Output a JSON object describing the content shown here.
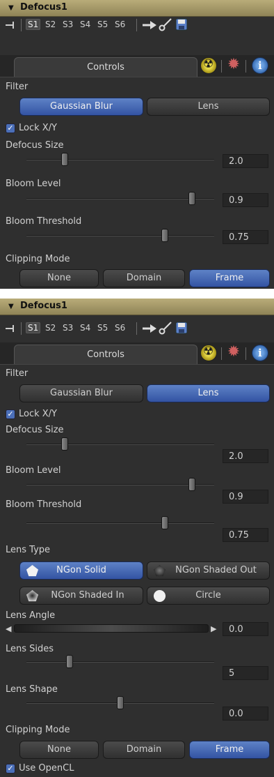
{
  "top": {
    "title": "Defocus1",
    "toolbar": {
      "slots": [
        "S1",
        "S2",
        "S3",
        "S4",
        "S5",
        "S6"
      ],
      "icons": [
        "pin-icon",
        "arrow-right-icon",
        "link-icon",
        "save-icon"
      ]
    },
    "tabs": {
      "controls": "Controls",
      "icons": [
        "radiation-icon",
        "gear-icon",
        "info-icon"
      ]
    },
    "filter": {
      "label": "Filter",
      "options": [
        "Gaussian Blur",
        "Lens"
      ],
      "selected": "Gaussian Blur"
    },
    "lock_xy": {
      "label": "Lock X/Y",
      "checked": true
    },
    "sliders": [
      {
        "label": "Defocus Size",
        "value": "2.0",
        "fraction": 0.22
      },
      {
        "label": "Bloom Level",
        "value": "0.9",
        "fraction": 0.9
      },
      {
        "label": "Bloom Threshold",
        "value": "0.75",
        "fraction": 0.75
      }
    ],
    "clipping": {
      "label": "Clipping Mode",
      "options": [
        "None",
        "Domain",
        "Frame"
      ],
      "selected": "Frame"
    }
  },
  "bottom": {
    "title": "Defocus1",
    "toolbar": {
      "slots": [
        "S1",
        "S2",
        "S3",
        "S4",
        "S5",
        "S6"
      ],
      "icons": [
        "pin-icon",
        "arrow-right-icon",
        "link-icon",
        "save-icon"
      ]
    },
    "tabs": {
      "controls": "Controls",
      "icons": [
        "radiation-icon",
        "gear-icon",
        "info-icon"
      ]
    },
    "filter": {
      "label": "Filter",
      "options": [
        "Gaussian Blur",
        "Lens"
      ],
      "selected": "Lens"
    },
    "lock_xy": {
      "label": "Lock X/Y",
      "checked": true
    },
    "sliders": [
      {
        "label": "Defocus Size",
        "value": "2.0",
        "fraction": 0.22
      },
      {
        "label": "Bloom Level",
        "value": "0.9",
        "fraction": 0.9
      },
      {
        "label": "Bloom Threshold",
        "value": "0.75",
        "fraction": 0.75
      }
    ],
    "lens_type": {
      "label": "Lens Type",
      "options": [
        "NGon Solid",
        "NGon Shaded Out",
        "NGon Shaded In",
        "Circle"
      ],
      "selected": "NGon Solid"
    },
    "lens_angle": {
      "label": "Lens Angle",
      "value": "0.0"
    },
    "lens_sides": {
      "label": "Lens Sides",
      "value": "5",
      "fraction": 0.23
    },
    "lens_shape": {
      "label": "Lens Shape",
      "value": "0.0",
      "fraction": 0.5
    },
    "clipping": {
      "label": "Clipping Mode",
      "options": [
        "None",
        "Domain",
        "Frame"
      ],
      "selected": "Frame"
    },
    "opencl": {
      "label": "Use OpenCL",
      "checked": true
    }
  }
}
